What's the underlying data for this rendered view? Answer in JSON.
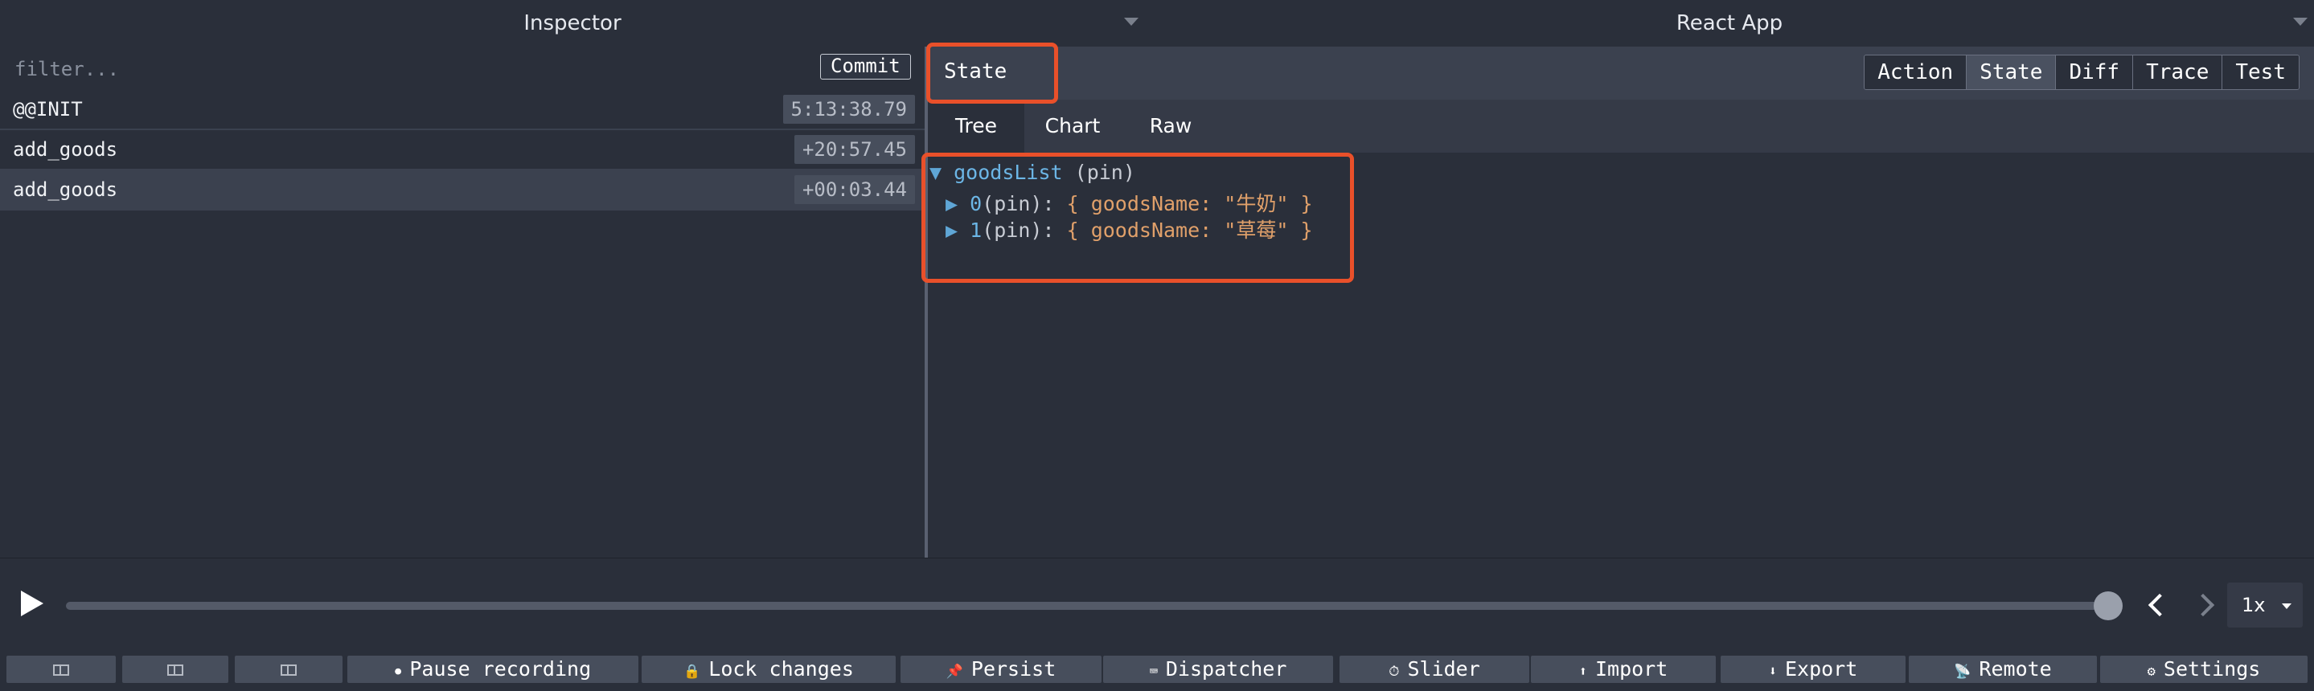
{
  "header": {
    "left_select": "Inspector",
    "right_select": "React App"
  },
  "filter": {
    "placeholder": "filter...",
    "commit_label": "Commit"
  },
  "actions": [
    {
      "name": "@@INIT",
      "time": "5:13:38.79"
    },
    {
      "name": "add_goods",
      "time": "+20:57.45"
    },
    {
      "name": "add_goods",
      "time": "+00:03.44"
    }
  ],
  "monitor": {
    "title": "State",
    "tabs": [
      "Action",
      "State",
      "Diff",
      "Trace",
      "Test"
    ],
    "active_tab": "State",
    "sub_tabs": [
      "Tree",
      "Chart",
      "Raw"
    ],
    "active_sub_tab": "Tree"
  },
  "tree": {
    "root_key": "goodsList",
    "root_label": "(pin)",
    "items": [
      {
        "index": "0",
        "label": "(pin):",
        "open": "{",
        "field": "goodsName:",
        "value": "\"牛奶\"",
        "close": "}"
      },
      {
        "index": "1",
        "label": "(pin):",
        "open": "{",
        "field": "goodsName:",
        "value": "\"草莓\"",
        "close": "}"
      }
    ]
  },
  "slider": {
    "speed": "1x",
    "position": 1.0
  },
  "bottom_buttons": {
    "pause": "Pause recording",
    "lock": "Lock changes",
    "persist": "Persist",
    "dispatcher": "Dispatcher",
    "slider": "Slider",
    "import": "Import",
    "export": "Export",
    "remote": "Remote",
    "settings": "Settings"
  },
  "colors": {
    "highlight": "#e9502a",
    "background": "#2a2f3a",
    "accent": "#6cb6e6"
  }
}
